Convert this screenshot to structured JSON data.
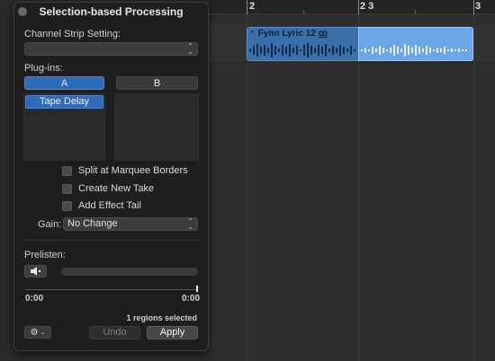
{
  "timeline": {
    "ruler_labels": [
      "2",
      "2 3",
      "3"
    ],
    "region": {
      "name": "Fynn Lyric 12",
      "loop_glyph": "ꝏ"
    }
  },
  "panel": {
    "title": "Selection-based Processing",
    "channel_strip_label": "Channel Strip Setting:",
    "channel_strip_value": "",
    "plugins_label": "Plug-ins:",
    "tab_a": "A",
    "tab_b": "B",
    "plugin_a_slots": [
      "Tape Delay"
    ],
    "options": [
      {
        "label": "Split at Marquee Borders",
        "checked": false
      },
      {
        "label": "Create New Take",
        "checked": false
      },
      {
        "label": "Add Effect Tail",
        "checked": false
      }
    ],
    "gain_label": "Gain:",
    "gain_value": "No Change",
    "prelisten_label": "Prelisten:",
    "time_start": "0:00",
    "time_end": "0:00",
    "status_text": "1 regions selected",
    "undo_label": "Undo",
    "apply_label": "Apply"
  },
  "colors": {
    "accent_blue": "#2f6bb8",
    "region_blue": "#3b6fa8",
    "region_selected": "#6aa6e8"
  },
  "icons": {
    "close": "close-dot-icon",
    "updown": "updown-arrows-icon",
    "speaker": "speaker-icon",
    "gear": "gear-icon",
    "chevron": "chevron-down-icon"
  }
}
